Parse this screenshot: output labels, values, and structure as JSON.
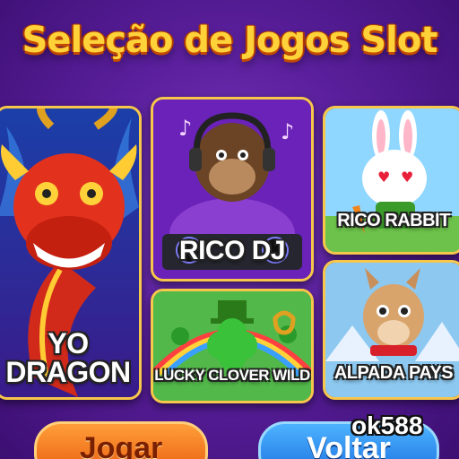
{
  "header": {
    "title": "Seleção de Jogos Slot"
  },
  "games": [
    {
      "label_lines": [
        "YO",
        "DRAGON"
      ],
      "art": "red-dragon"
    },
    {
      "label_lines": [
        "RICO DJ"
      ],
      "art": "gorilla-dj"
    },
    {
      "label_lines": [
        "RICO RABBIT"
      ],
      "art": "white-rabbit"
    },
    {
      "label_lines": [
        "LUCKY CLOVER WILD"
      ],
      "art": "clover-leprechaun"
    },
    {
      "label_lines": [
        "ALPADA PAYS"
      ],
      "art": "alpaca"
    }
  ],
  "buttons": {
    "play": "Jogar",
    "back": "Voltar"
  },
  "watermark": {
    "text": "ok588"
  },
  "colors": {
    "title": "#ffd23a",
    "frame": "#f6c74a",
    "play": "#f07a1c",
    "back": "#2a88f0",
    "background": "#5a1f9c"
  }
}
